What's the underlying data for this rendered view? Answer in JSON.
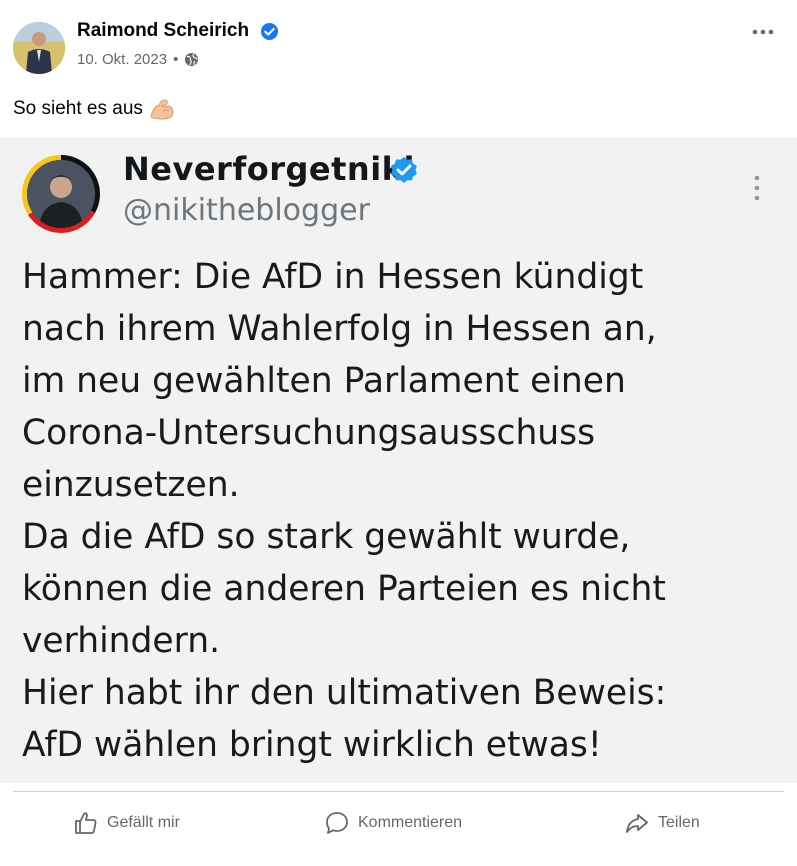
{
  "post": {
    "author": "Raimond Scheirich",
    "date": "10. Okt. 2023",
    "separator": "•",
    "text": "So sieht es aus"
  },
  "tweet": {
    "name": "Neverforgetniki",
    "handle": "@nikitheblogger",
    "lines": [
      "Hammer: Die AfD in Hessen kündigt",
      "nach ihrem Wahlerfolg in Hessen an,",
      "im neu gewählten Parlament einen",
      "Corona-Untersuchungsausschuss",
      "einzusetzen.",
      "Da die AfD so stark gewählt wurde,",
      "können die anderen Parteien es nicht",
      "verhindern.",
      "Hier habt ihr den ultimativen Beweis:",
      "AfD wählen bringt wirklich etwas!"
    ]
  },
  "actions": {
    "like": "Gefällt mir",
    "comment": "Kommentieren",
    "share": "Teilen"
  },
  "icons": {
    "verified": "verified-badge-icon",
    "globe": "globe-icon",
    "more": "more-options-icon",
    "emoji": "flexed-biceps-emoji",
    "like": "thumbs-up-icon",
    "comment": "comment-bubble-icon",
    "share": "share-arrow-icon"
  },
  "colors": {
    "verified": "#1877f2",
    "tweet_verified": "#1d9bf0",
    "muted": "#65676b",
    "embed_bg": "#f2f2f2"
  }
}
